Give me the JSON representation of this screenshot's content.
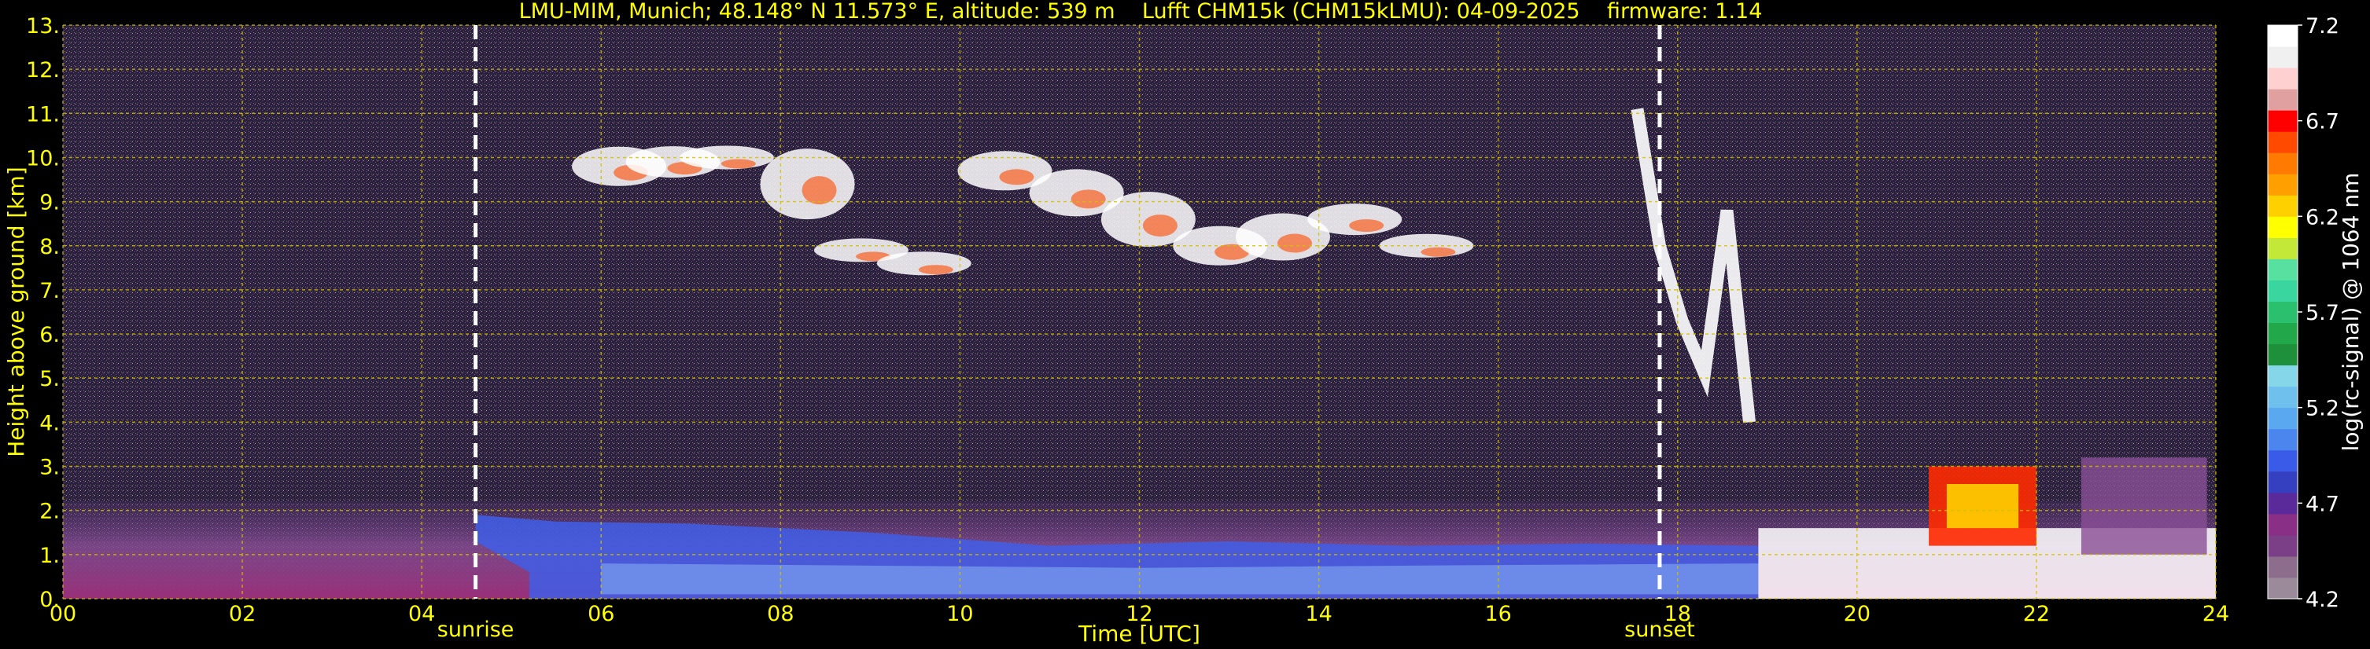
{
  "title": "LMU-MIM, Munich; 48.148° N 11.573° E, altitude: 539 m    Lufft CHM15k (CHM15kLMU): 04-09-2025    firmware: 1.14",
  "chart_data": {
    "type": "heatmap",
    "xlabel": "Time [UTC]",
    "ylabel": "Height above ground [km]",
    "xlim": [
      0,
      24
    ],
    "ylim": [
      0,
      13
    ],
    "x_ticks": [
      "00",
      "02",
      "04",
      "06",
      "08",
      "10",
      "12",
      "14",
      "16",
      "18",
      "20",
      "22",
      "24"
    ],
    "y_ticks": [
      "0.",
      "1.",
      "2.",
      "3.",
      "4.",
      "5.",
      "6.",
      "7.",
      "8.",
      "9.",
      "10.",
      "11.",
      "12.",
      "13."
    ],
    "grid": true,
    "colorbar": {
      "label": "log(rc-signal) @ 1064 nm",
      "range": [
        4.2,
        7.2
      ],
      "ticks": [
        "4.2",
        "4.7",
        "5.2",
        "5.7",
        "6.2",
        "6.7",
        "7.2"
      ],
      "colors": [
        "#9a8a9a",
        "#8c6d8c",
        "#7a3f86",
        "#8a2f86",
        "#5a2a9a",
        "#3440c0",
        "#3a5ae8",
        "#4a86ee",
        "#5aa8f0",
        "#70c0ee",
        "#86d6ea",
        "#1e8f3a",
        "#22a84a",
        "#2ac06e",
        "#3ad6a0",
        "#58e0a0",
        "#c4e838",
        "#ffff00",
        "#ffd000",
        "#ffa000",
        "#ff7a00",
        "#ff4a00",
        "#ff0000",
        "#e0a0a0",
        "#ffd0d0",
        "#f0f0f0",
        "#ffffff"
      ]
    },
    "annotations": [
      {
        "text": "sunrise",
        "x": 4.6
      },
      {
        "text": "sunset",
        "x": 17.8
      }
    ],
    "features": [
      {
        "name": "boundary layer",
        "x_range": [
          0,
          24
        ],
        "height_km": [
          0,
          2
        ]
      },
      {
        "name": "cirrus",
        "x_range": [
          5.8,
          15.6
        ],
        "height_km": [
          7.2,
          10.5
        ]
      },
      {
        "name": "descending cloud",
        "x_range": [
          17.5,
          18.8
        ],
        "height_km": [
          3.5,
          11.2
        ]
      },
      {
        "name": "low cloud",
        "x_range": [
          18.8,
          24
        ],
        "height_km": [
          0,
          3.6
        ]
      }
    ]
  }
}
